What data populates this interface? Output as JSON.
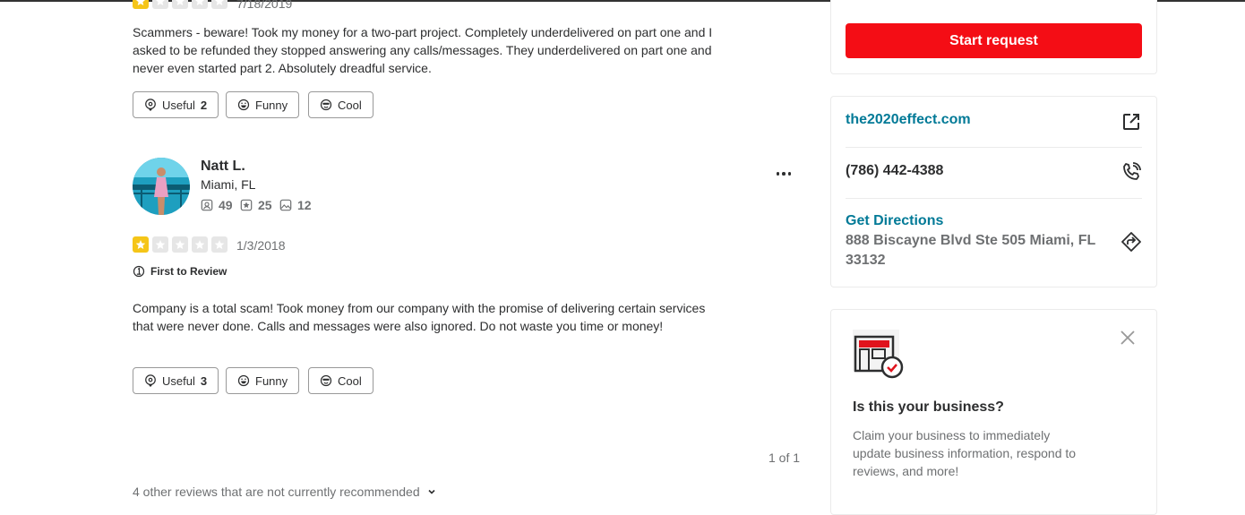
{
  "review1": {
    "rating": 1,
    "date": "7/18/2019",
    "text": "Scammers - beware! Took my money for a two-part project. Completely underdelivered on part one and I asked to be refunded they stopped answering any calls/messages. They underdelivered on part one and never even started part 2. Absolutely dreadful service.",
    "useful_label": "Useful",
    "useful_count": "2",
    "funny_label": "Funny",
    "cool_label": "Cool"
  },
  "review2": {
    "user_name": "Natt L.",
    "user_location": "Miami, FL",
    "friends_count": "49",
    "reviews_count": "25",
    "photos_count": "12",
    "rating": 1,
    "date": "1/3/2018",
    "badge": "First to Review",
    "text": "Company is a total scam! Took money from our company with the promise of delivering certain services that were never done. Calls and messages were also ignored. Do not waste you time or money!",
    "useful_label": "Useful",
    "useful_count": "3",
    "funny_label": "Funny",
    "cool_label": "Cool"
  },
  "pagination": {
    "text": "1 of 1"
  },
  "other_reviews": {
    "text": "4 other reviews that are not currently recommended"
  },
  "sidebar": {
    "request_button": "Start request",
    "website": "the2020effect.com",
    "phone": "(786) 442-4388",
    "directions_label": "Get Directions",
    "address": "888 Biscayne Blvd Ste 505 Miami, FL 33132",
    "claim_title": "Is this your business?",
    "claim_text": "Claim your business to immediately update business information, respond to reviews, and more!"
  },
  "colors": {
    "accent_red": "#f40d15",
    "link_teal": "#027a97",
    "star_on": "#f5c518",
    "star_off": "#e6e6e6"
  },
  "icons": {
    "website": "external-link-icon",
    "phone": "phone-icon",
    "directions": "directions-icon",
    "close": "close-icon"
  }
}
